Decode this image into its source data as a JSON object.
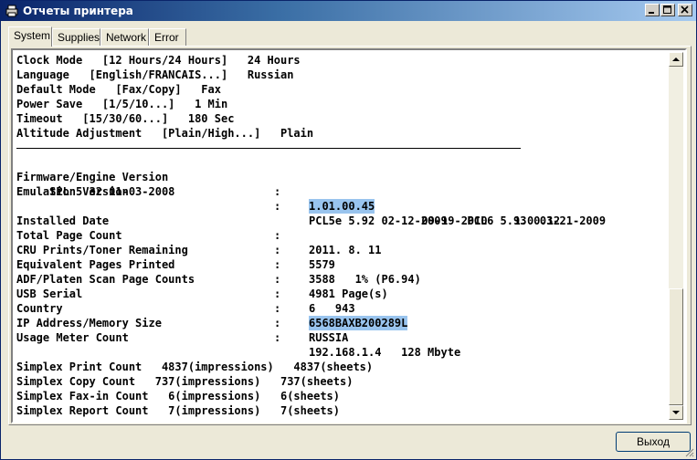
{
  "window": {
    "title": "Отчеты принтера"
  },
  "tabs": [
    "System",
    "Supplies",
    "Network",
    "Error"
  ],
  "report": {
    "top_lines": [
      "Clock Mode   [12 Hours/24 Hours]   24 Hours",
      "Language   [English/FRANCAIS...]   Russian",
      "Default Mode   [Fax/Copy]   Fax",
      "Power Save   [1/5/10...]   1 Min",
      "Timeout   [15/30/60...]   180 Sec",
      "Altitude Adjustment   [Plain/High...]   Plain"
    ],
    "info": [
      {
        "label": "Firmware/Engine Version",
        "sep": ":",
        "value": "1.01.00.45",
        "extra": "      09-19-2010    1.00.12",
        "highlight": true
      },
      {
        "label": "Emulation Version",
        "sep": ":",
        "value": "PCL5e 5.92 02-12-2009   PCL6 5.93  03-21-2009",
        "extra": "",
        "highlight": false
      },
      {
        "label": "",
        "sep": "",
        "value": "",
        "extra": "",
        "highlight": false,
        "continuation": "     SPL 5.32 01-03-2008"
      },
      {
        "label": "Installed Date",
        "sep": ":",
        "value": "2011. 8. 11",
        "extra": "",
        "highlight": false
      },
      {
        "label": "Total Page Count",
        "sep": ":",
        "value": "5579",
        "extra": "",
        "highlight": false
      },
      {
        "label": "CRU Prints/Toner Remaining",
        "sep": ":",
        "value": "3588   1% (P6.94)",
        "extra": "",
        "highlight": false
      },
      {
        "label": "Equivalent Pages Printed",
        "sep": ":",
        "value": "4981 Page(s)",
        "extra": "",
        "highlight": false
      },
      {
        "label": "ADF/Platen Scan Page Counts",
        "sep": ":",
        "value": "6   943",
        "extra": "",
        "highlight": false
      },
      {
        "label": "USB Serial",
        "sep": ":",
        "value": "6568BAXB200289L",
        "extra": "",
        "highlight": true
      },
      {
        "label": "Country",
        "sep": ":",
        "value": "RUSSIA",
        "extra": "",
        "highlight": false
      },
      {
        "label": "IP Address/Memory Size",
        "sep": ":",
        "value": "192.168.1.4   128 Mbyte",
        "extra": "",
        "highlight": false
      }
    ],
    "usage_heading": "Usage Meter Count",
    "usage_lines": [
      "Simplex Print Count   4837(impressions)   4837(sheets)",
      "Simplex Copy Count   737(impressions)   737(sheets)",
      "Simplex Fax-in Count   6(impressions)   6(sheets)",
      "Simplex Report Count   7(impressions)   7(sheets)"
    ]
  },
  "buttons": {
    "exit": "Выход"
  },
  "icons": {
    "app": "printer-app-icon",
    "minimize": "minimize-icon",
    "maximize": "maximize-icon",
    "close": "close-icon"
  }
}
